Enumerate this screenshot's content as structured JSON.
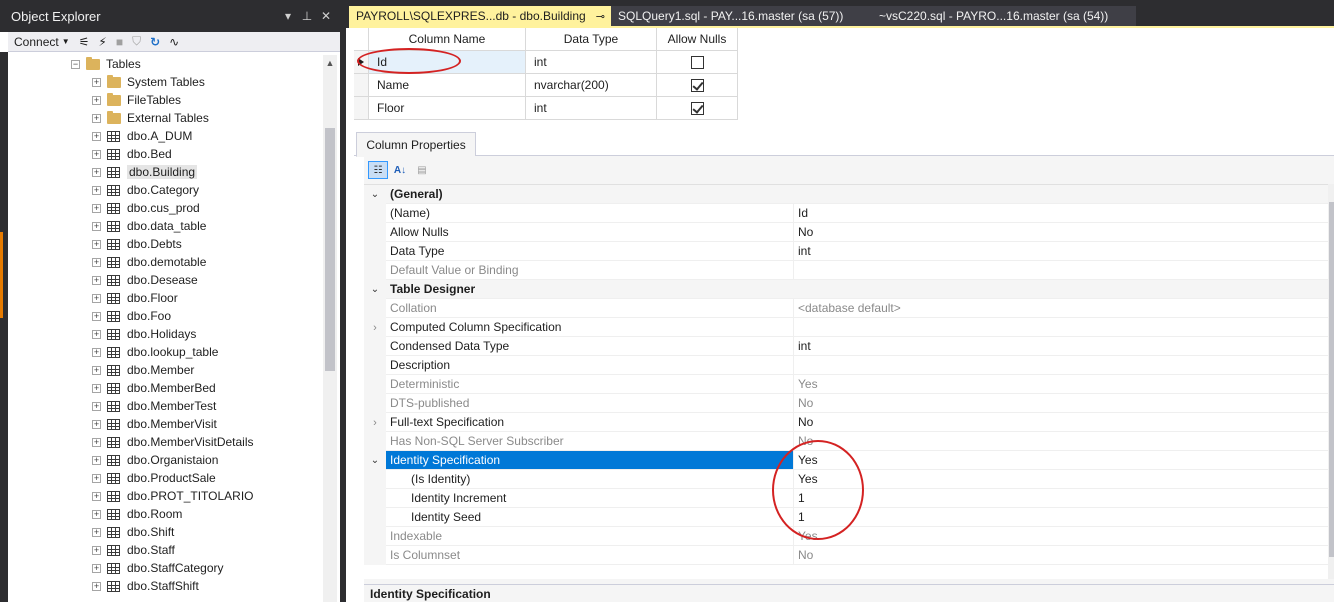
{
  "object_explorer": {
    "title": "Object Explorer",
    "header_icons": [
      "dropdown-icon",
      "pin-icon",
      "close-icon"
    ],
    "toolbar": {
      "connect_label": "Connect"
    },
    "tree": [
      {
        "label": "Tables",
        "kind": "folder",
        "expander": "⊟"
      },
      {
        "label": "System Tables",
        "kind": "folder",
        "expander": "⊞"
      },
      {
        "label": "FileTables",
        "kind": "folder",
        "expander": "⊞"
      },
      {
        "label": "External Tables",
        "kind": "folder",
        "expander": "⊞"
      },
      {
        "label": "dbo.A_DUM",
        "kind": "table",
        "expander": "⊞"
      },
      {
        "label": "dbo.Bed",
        "kind": "table",
        "expander": "⊞"
      },
      {
        "label": "dbo.Building",
        "kind": "table",
        "expander": "⊞",
        "selected": true
      },
      {
        "label": "dbo.Category",
        "kind": "table",
        "expander": "⊞"
      },
      {
        "label": "dbo.cus_prod",
        "kind": "table",
        "expander": "⊞"
      },
      {
        "label": "dbo.data_table",
        "kind": "table",
        "expander": "⊞"
      },
      {
        "label": "dbo.Debts",
        "kind": "table",
        "expander": "⊞"
      },
      {
        "label": "dbo.demotable",
        "kind": "table",
        "expander": "⊞"
      },
      {
        "label": "dbo.Desease",
        "kind": "table",
        "expander": "⊞"
      },
      {
        "label": "dbo.Floor",
        "kind": "table",
        "expander": "⊞"
      },
      {
        "label": "dbo.Foo",
        "kind": "table",
        "expander": "⊞"
      },
      {
        "label": "dbo.Holidays",
        "kind": "table",
        "expander": "⊞"
      },
      {
        "label": "dbo.lookup_table",
        "kind": "table",
        "expander": "⊞"
      },
      {
        "label": "dbo.Member",
        "kind": "table",
        "expander": "⊞"
      },
      {
        "label": "dbo.MemberBed",
        "kind": "table",
        "expander": "⊞"
      },
      {
        "label": "dbo.MemberTest",
        "kind": "table",
        "expander": "⊞"
      },
      {
        "label": "dbo.MemberVisit",
        "kind": "table",
        "expander": "⊞"
      },
      {
        "label": "dbo.MemberVisitDetails",
        "kind": "table",
        "expander": "⊞"
      },
      {
        "label": "dbo.Organistaion",
        "kind": "table",
        "expander": "⊞"
      },
      {
        "label": "dbo.ProductSale",
        "kind": "table",
        "expander": "⊞"
      },
      {
        "label": "dbo.PROT_TITOLARIO",
        "kind": "table",
        "expander": "⊞"
      },
      {
        "label": "dbo.Room",
        "kind": "table",
        "expander": "⊞"
      },
      {
        "label": "dbo.Shift",
        "kind": "table",
        "expander": "⊞"
      },
      {
        "label": "dbo.Staff",
        "kind": "table",
        "expander": "⊞"
      },
      {
        "label": "dbo.StaffCategory",
        "kind": "table",
        "expander": "⊞"
      },
      {
        "label": "dbo.StaffShift",
        "kind": "table",
        "expander": "⊞"
      }
    ]
  },
  "tabs": [
    {
      "label": "PAYROLL\\SQLEXPRES...db - dbo.Building",
      "active": true
    },
    {
      "label": "SQLQuery1.sql - PAY...16.master (sa (57))"
    },
    {
      "label": "~vsC220.sql - PAYRO...16.master (sa (54))"
    }
  ],
  "grid": {
    "headers": [
      "Column Name",
      "Data Type",
      "Allow Nulls"
    ],
    "rows": [
      {
        "name": "Id",
        "type": "int",
        "allow_nulls": false,
        "current": true
      },
      {
        "name": "Name",
        "type": "nvarchar(200)",
        "allow_nulls": true
      },
      {
        "name": "Floor",
        "type": "int",
        "allow_nulls": true
      }
    ]
  },
  "column_properties": {
    "tab_label": "Column Properties",
    "description_title": "Identity Specification",
    "rows": [
      {
        "kind": "cat",
        "name": "(General)",
        "value": ""
      },
      {
        "name": "(Name)",
        "value": "Id"
      },
      {
        "name": "Allow Nulls",
        "value": "No"
      },
      {
        "name": "Data Type",
        "value": "int"
      },
      {
        "name": "Default Value or Binding",
        "value": "",
        "dim": true
      },
      {
        "kind": "cat",
        "name": "Table Designer",
        "value": ""
      },
      {
        "name": "Collation",
        "value": "<database default>",
        "dim": true
      },
      {
        "name": "Computed Column Specification",
        "value": "",
        "collapsed": true
      },
      {
        "name": "Condensed Data Type",
        "value": "int"
      },
      {
        "name": "Description",
        "value": ""
      },
      {
        "name": "Deterministic",
        "value": "Yes",
        "dim": true
      },
      {
        "name": "DTS-published",
        "value": "No",
        "dim": true
      },
      {
        "name": "Full-text Specification",
        "value": "No",
        "collapsed": true
      },
      {
        "name": "Has Non-SQL Server Subscriber",
        "value": "No",
        "dim": true
      },
      {
        "name": "Identity Specification",
        "value": "Yes",
        "expanded": true,
        "highlight": true
      },
      {
        "name": "(Is Identity)",
        "value": "Yes",
        "sub": true
      },
      {
        "name": "Identity Increment",
        "value": "1",
        "sub": true
      },
      {
        "name": "Identity Seed",
        "value": "1",
        "sub": true
      },
      {
        "name": "Indexable",
        "value": "Yes",
        "dim": true
      },
      {
        "name": "Is Columnset",
        "value": "No",
        "dim": true
      }
    ]
  },
  "colors": {
    "active_tab": "#fff29d",
    "selection": "#0078d7",
    "annotation": "#d42222",
    "chrome": "#2d2d30"
  }
}
